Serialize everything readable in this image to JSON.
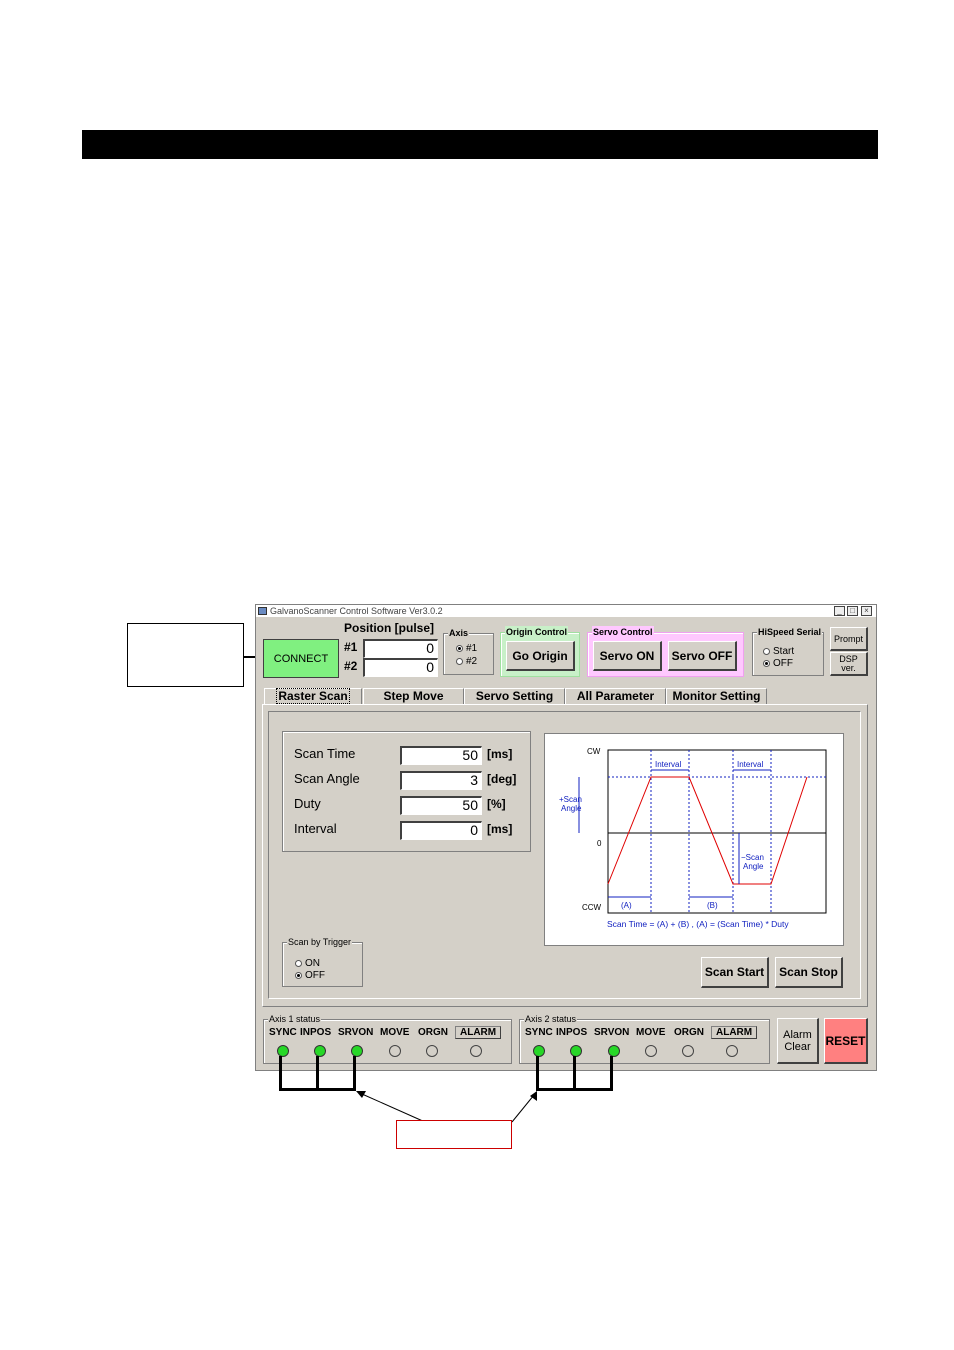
{
  "colors": {
    "connect_bg": "#80f080",
    "reset_bg": "#ff8080",
    "origin_group_bg": "#c8f0c8",
    "servo_group_bg": "#ffc8ff",
    "led_on": "#27d727",
    "diagram_red": "#e00000",
    "diagram_blue": "#1020c0"
  },
  "window": {
    "title": "GalvanoScanner Control Software Ver3.0.2"
  },
  "toolbar": {
    "connect_label": "CONNECT",
    "position_header": "Position [pulse]",
    "pos1_label": "#1",
    "pos1_value": "0",
    "pos2_label": "#2",
    "pos2_value": "0",
    "axis_group": "Axis",
    "axis_opt1": "#1",
    "axis_opt2": "#2",
    "origin_group": "Origin Control",
    "go_origin": "Go Origin",
    "servo_group": "Servo Control",
    "servo_on": "Servo ON",
    "servo_off": "Servo OFF",
    "hispeed_group": "HiSpeed Serial",
    "hispeed_start": "Start",
    "hispeed_off": "OFF",
    "prompt": "Prompt",
    "dsp_ver_line1": "DSP",
    "dsp_ver_line2": "ver."
  },
  "tabs": [
    "Raster Scan",
    "Step Move",
    "Servo Setting",
    "All Parameter",
    "Monitor Setting"
  ],
  "params": [
    {
      "label": "Scan Time",
      "value": "50",
      "unit": "[ms]"
    },
    {
      "label": "Scan Angle",
      "value": "3",
      "unit": "[deg]"
    },
    {
      "label": "Duty",
      "value": "50",
      "unit": "[%]"
    },
    {
      "label": "Interval",
      "value": "0",
      "unit": "[ms]"
    }
  ],
  "trigger": {
    "group": "Scan by Trigger",
    "on": "ON",
    "off": "OFF"
  },
  "diagram": {
    "cw": "CW",
    "zero": "0",
    "ccw": "CCW",
    "interval1": "Interval",
    "interval2": "Interval",
    "plus_scan_1": "+Scan",
    "plus_scan_2": "Angle",
    "minus_scan_1": "−Scan",
    "minus_scan_2": "Angle",
    "seg_a": "(A)",
    "seg_b": "(B)",
    "formula": "Scan Time = (A) + (B) ,   (A) = (Scan Time) * Duty"
  },
  "scan_start": "Scan Start",
  "scan_stop": "Scan Stop",
  "axis1": {
    "title": "Axis 1 status",
    "labels": [
      "SYNC",
      "INPOS",
      "SRVON",
      "MOVE",
      "ORGN",
      "ALARM"
    ],
    "states": [
      true,
      true,
      true,
      false,
      false,
      false
    ]
  },
  "axis2": {
    "title": "Axis 2 status",
    "labels": [
      "SYNC",
      "INPOS",
      "SRVON",
      "MOVE",
      "ORGN",
      "ALARM"
    ],
    "states": [
      true,
      true,
      true,
      false,
      false,
      false
    ]
  },
  "alarm_clear_line1": "Alarm",
  "alarm_clear_line2": "Clear",
  "reset": "RESET"
}
